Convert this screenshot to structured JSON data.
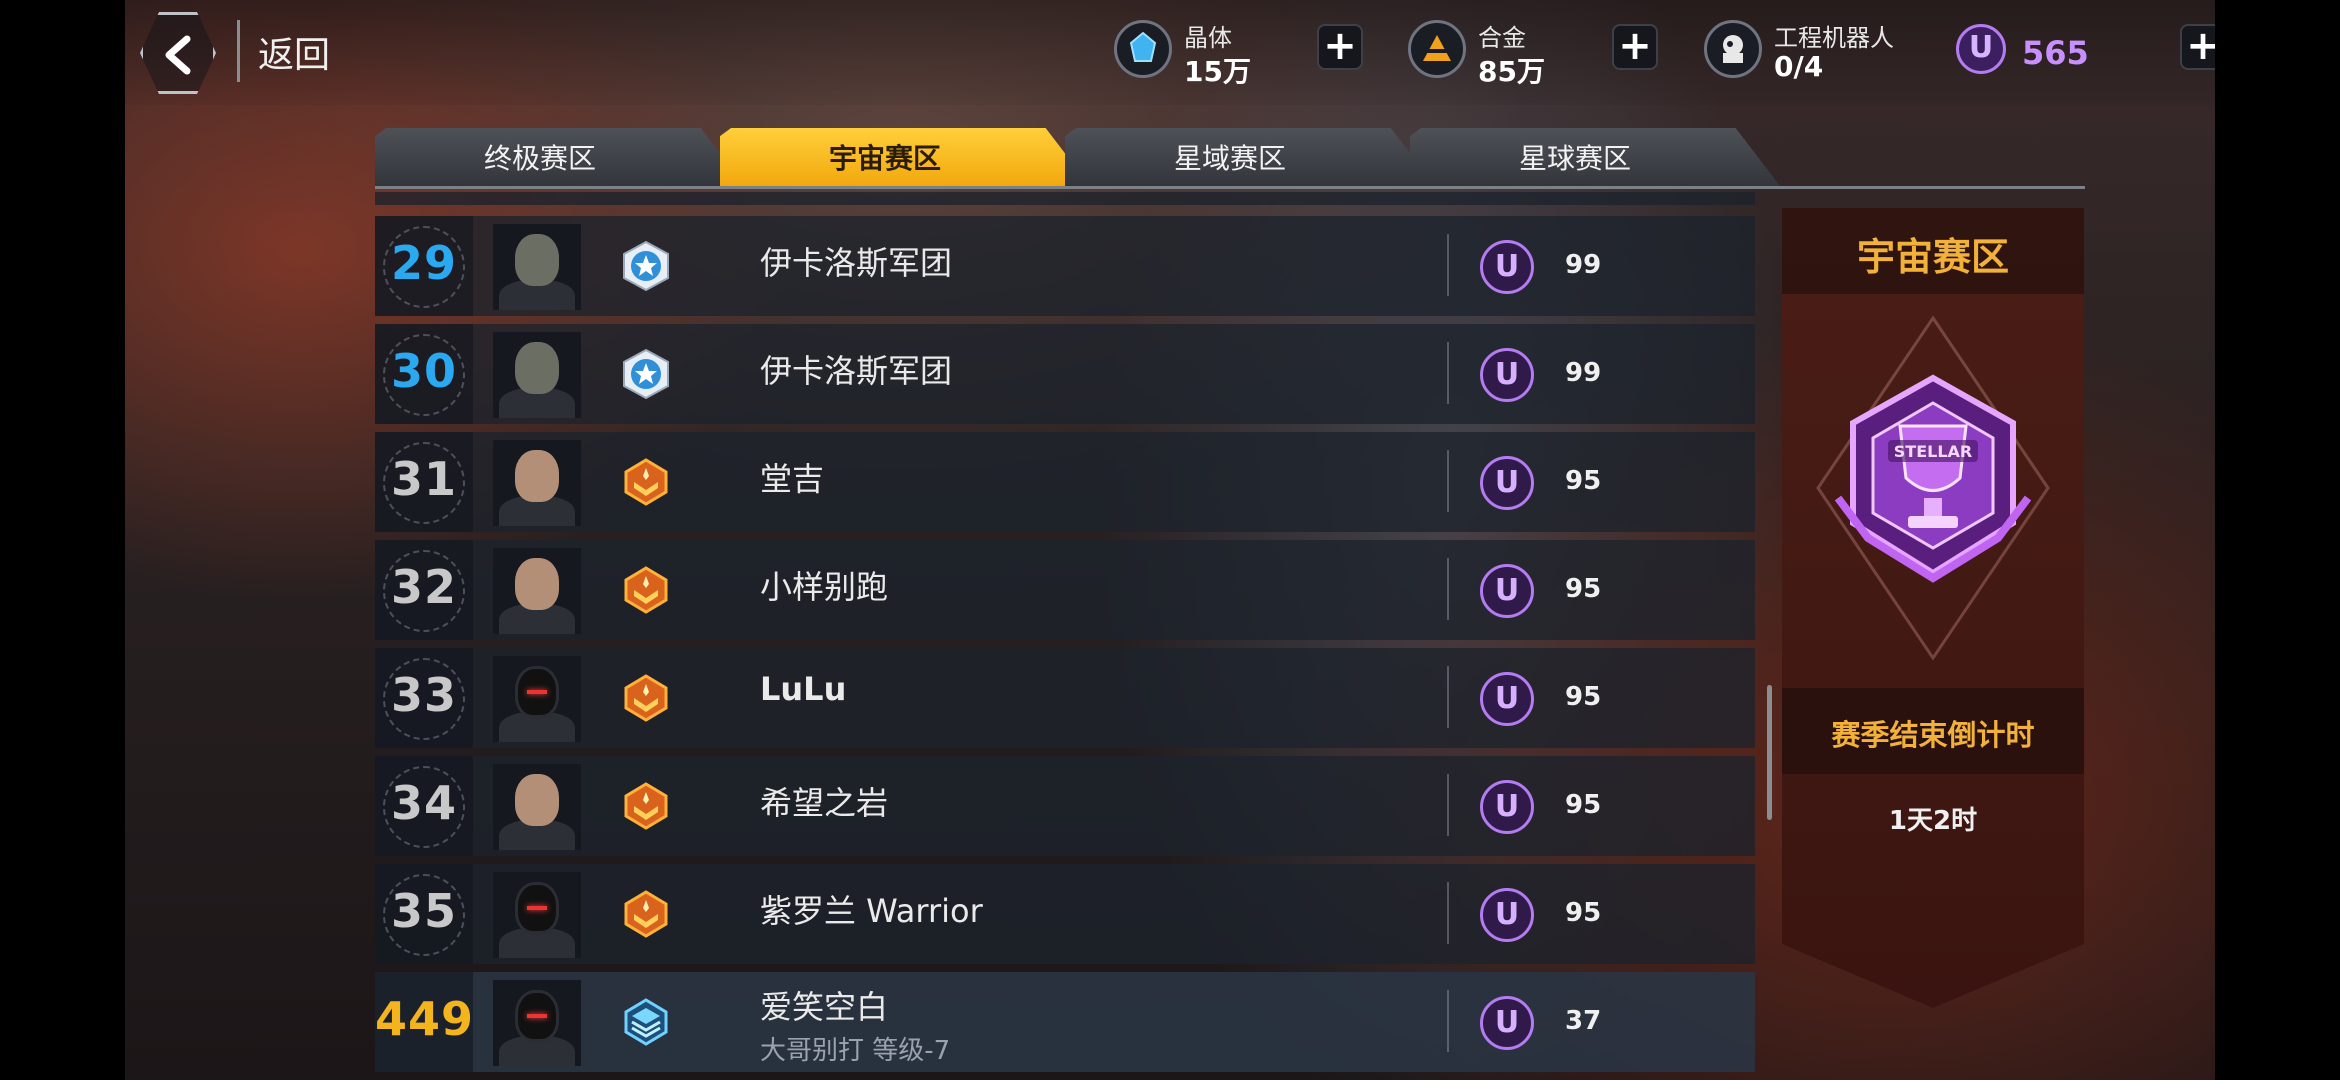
{
  "header": {
    "back_label": "返回",
    "resources": [
      {
        "label": "晶体",
        "value": "15万",
        "icon": "crystal-icon"
      },
      {
        "label": "合金",
        "value": "85万",
        "icon": "alloy-icon"
      },
      {
        "label": "工程机器人",
        "value": "0/4",
        "icon": "robot-icon"
      }
    ],
    "u_currency": {
      "symbol": "U",
      "value": "565"
    }
  },
  "tabs": [
    {
      "label": "终极赛区",
      "active": false
    },
    {
      "label": "宇宙赛区",
      "active": true
    },
    {
      "label": "星域赛区",
      "active": false
    },
    {
      "label": "星球赛区",
      "active": false
    }
  ],
  "rows": [
    {
      "rank": "29",
      "avatar": "alien",
      "badge": "star-badge",
      "name": "伊卡洛斯军团",
      "score": "99"
    },
    {
      "rank": "30",
      "avatar": "alien",
      "badge": "star-badge",
      "name": "伊卡洛斯军团",
      "score": "99"
    },
    {
      "rank": "31",
      "avatar": "human",
      "badge": "gold-rank-badge",
      "name": "堂吉",
      "score": "95"
    },
    {
      "rank": "32",
      "avatar": "human",
      "badge": "gold-rank-badge",
      "name": "小样别跑",
      "score": "95"
    },
    {
      "rank": "33",
      "avatar": "hood",
      "badge": "gold-rank-badge",
      "name": "LuLu",
      "score": "95"
    },
    {
      "rank": "34",
      "avatar": "human",
      "badge": "gold-rank-badge",
      "name": "希望之岩",
      "score": "95"
    },
    {
      "rank": "35",
      "avatar": "hood",
      "badge": "gold-rank-badge",
      "name": "紫罗兰 Warrior",
      "score": "95"
    }
  ],
  "self_row": {
    "rank": "449",
    "avatar": "hood",
    "badge": "stack-badge",
    "name": "爱笑空白",
    "subtitle": "大哥别打 等级-7",
    "score": "37"
  },
  "score_symbol": "U",
  "panel": {
    "title": "宇宙赛区",
    "trophy_text": "STELLAR",
    "countdown_label": "赛季结束倒计时",
    "countdown_value": "1天2时"
  },
  "colors": {
    "accent_gold": "#f2b13a",
    "tab_active": "#f7b81c",
    "rank_blue": "#2aa8f0",
    "currency_purple": "#b47cf0"
  }
}
